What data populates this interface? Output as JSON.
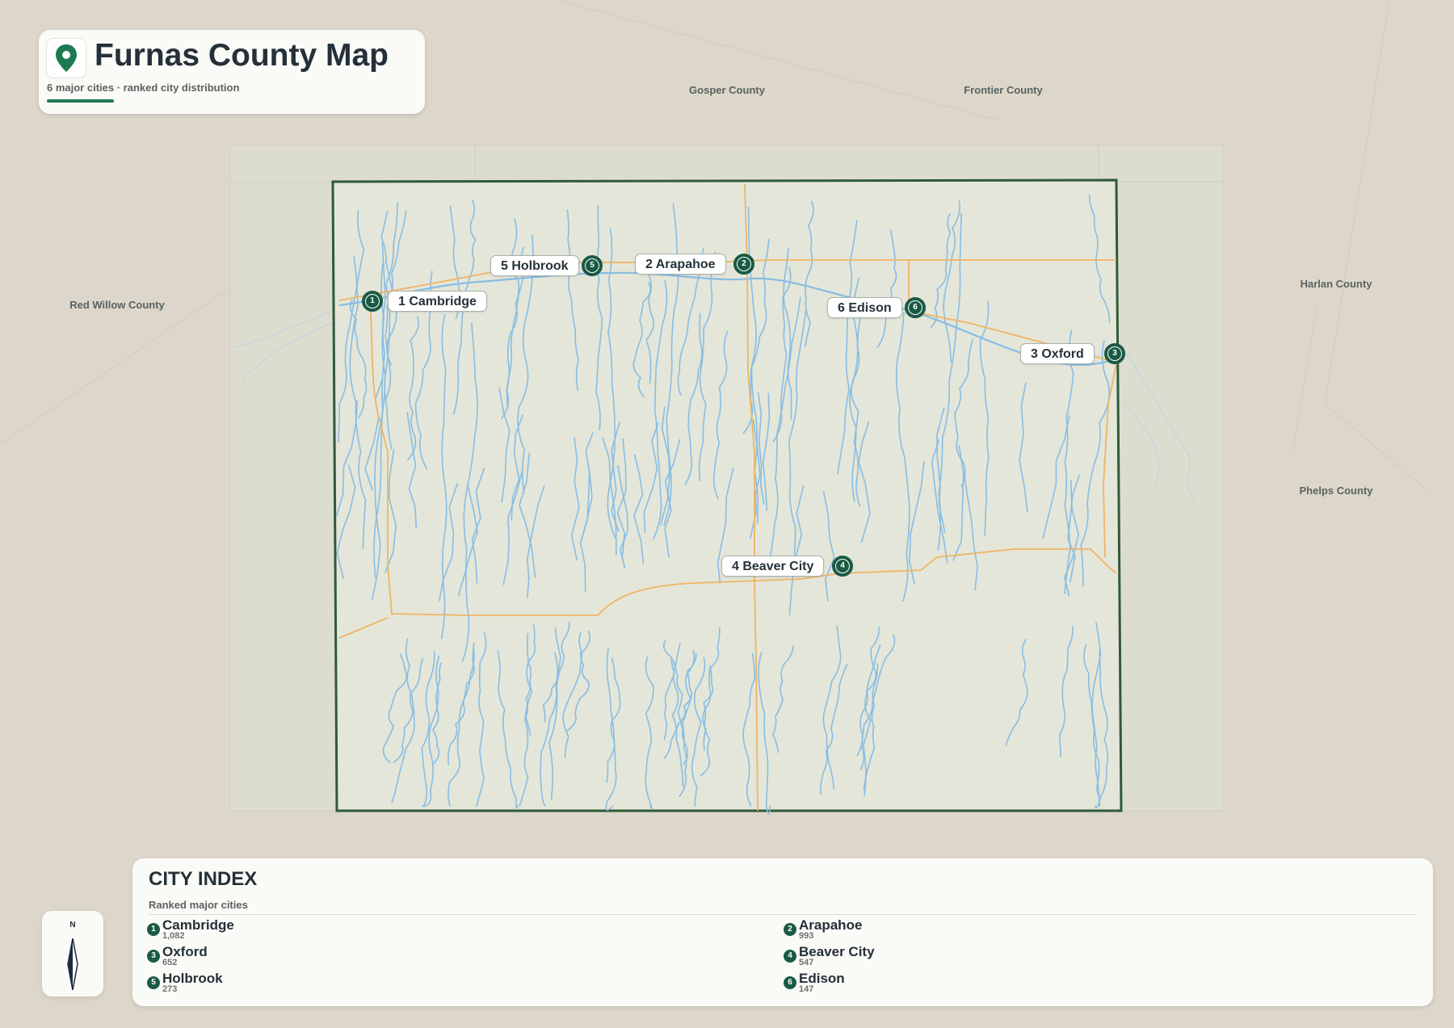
{
  "title": "Furnas County Map",
  "subtitle": "6 major cities · ranked city distribution",
  "neighbors": [
    {
      "name": "Gosper County"
    },
    {
      "name": "Frontier County"
    },
    {
      "name": "Red Willow County"
    },
    {
      "name": "Harlan County"
    },
    {
      "name": "Phelps County"
    }
  ],
  "cities": [
    {
      "rank": "1",
      "name": "Cambridge",
      "label": "1 Cambridge",
      "population": "1,082"
    },
    {
      "rank": "2",
      "name": "Arapahoe",
      "label": "2 Arapahoe",
      "population": "993"
    },
    {
      "rank": "3",
      "name": "Oxford",
      "label": "3 Oxford",
      "population": "652"
    },
    {
      "rank": "4",
      "name": "Beaver City",
      "label": "4 Beaver City",
      "population": "547"
    },
    {
      "rank": "5",
      "name": "Holbrook",
      "label": "5 Holbrook",
      "population": "273"
    },
    {
      "rank": "6",
      "name": "Edison",
      "label": "6 Edison",
      "population": "147"
    }
  ],
  "index": {
    "title": "CITY INDEX",
    "subtitle": "Ranked major cities"
  },
  "compass": {
    "label": "N"
  },
  "colors": {
    "accent": "#1e7a53",
    "marker": "#1a5a45",
    "county_border": "#2f5a36",
    "river": "#88bde3",
    "road": "#efb565"
  }
}
